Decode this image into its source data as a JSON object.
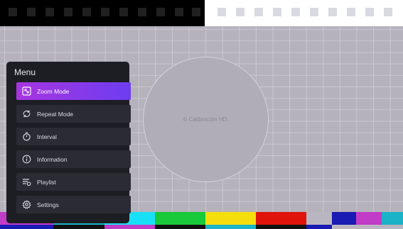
{
  "watermark": "© Calibración HD.",
  "menu": {
    "title": "Menu",
    "items": [
      {
        "label": "Zoom Mode",
        "icon": "zoom-icon",
        "active": true
      },
      {
        "label": "Repeat Mode",
        "icon": "repeat-icon",
        "active": false
      },
      {
        "label": "Interval",
        "icon": "timer-icon",
        "active": false
      },
      {
        "label": "Information",
        "icon": "info-icon",
        "active": false
      },
      {
        "label": "Playlist",
        "icon": "playlist-icon",
        "active": false
      },
      {
        "label": "Settings",
        "icon": "gear-icon",
        "active": false
      }
    ]
  },
  "colors": {
    "active_gradient_start": "#a735e0",
    "active_gradient_end": "#6d3df0",
    "menu_background": "#1d1d24",
    "menu_item_background": "#2b2b33",
    "grid_background": "#b5b2bb"
  },
  "color_bars": [
    "#c13cc7",
    "#1bb3c7",
    "#19e0f7",
    "#18c93a",
    "#f5de0c",
    "#e0140b",
    "#b9b6c1",
    "#1a1ab4",
    "#c13cc7",
    "#1bb3c7"
  ]
}
